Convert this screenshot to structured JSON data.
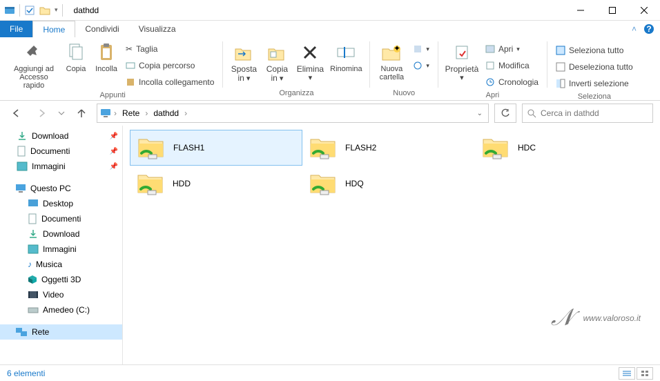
{
  "window": {
    "title": "dathdd"
  },
  "tabs": {
    "file": "File",
    "home": "Home",
    "share": "Condividi",
    "view": "Visualizza"
  },
  "ribbon": {
    "pin": "Aggiungi ad Accesso rapido",
    "copy": "Copia",
    "paste": "Incolla",
    "cut": "Taglia",
    "copy_path": "Copia percorso",
    "paste_link": "Incolla collegamento",
    "clipboard_group": "Appunti",
    "move_to": "Sposta in",
    "copy_to": "Copia in",
    "delete": "Elimina",
    "rename": "Rinomina",
    "organize_group": "Organizza",
    "new_folder": "Nuova cartella",
    "new_group": "Nuovo",
    "properties": "Proprietà",
    "open": "Apri",
    "edit": "Modifica",
    "history": "Cronologia",
    "open_group": "Apri",
    "select_all": "Seleziona tutto",
    "select_none": "Deseleziona tutto",
    "invert": "Inverti selezione",
    "select_group": "Seleziona"
  },
  "address": {
    "root": "Rete",
    "folder": "dathdd"
  },
  "search": {
    "placeholder": "Cerca in dathdd"
  },
  "tree": {
    "download": "Download",
    "documents": "Documenti",
    "pictures": "Immagini",
    "this_pc": "Questo PC",
    "desktop": "Desktop",
    "documents2": "Documenti",
    "download2": "Download",
    "pictures2": "Immagini",
    "music": "Musica",
    "objects3d": "Oggetti 3D",
    "video": "Video",
    "c_drive": "Amedeo (C:)",
    "network": "Rete"
  },
  "items": [
    {
      "name": "FLASH1",
      "selected": true
    },
    {
      "name": "FLASH2",
      "selected": false
    },
    {
      "name": "HDC",
      "selected": false
    },
    {
      "name": "HDD",
      "selected": false
    },
    {
      "name": "HDQ",
      "selected": false
    }
  ],
  "status": {
    "count": "6 elementi"
  },
  "watermark": {
    "text": "www.valoroso.it"
  }
}
